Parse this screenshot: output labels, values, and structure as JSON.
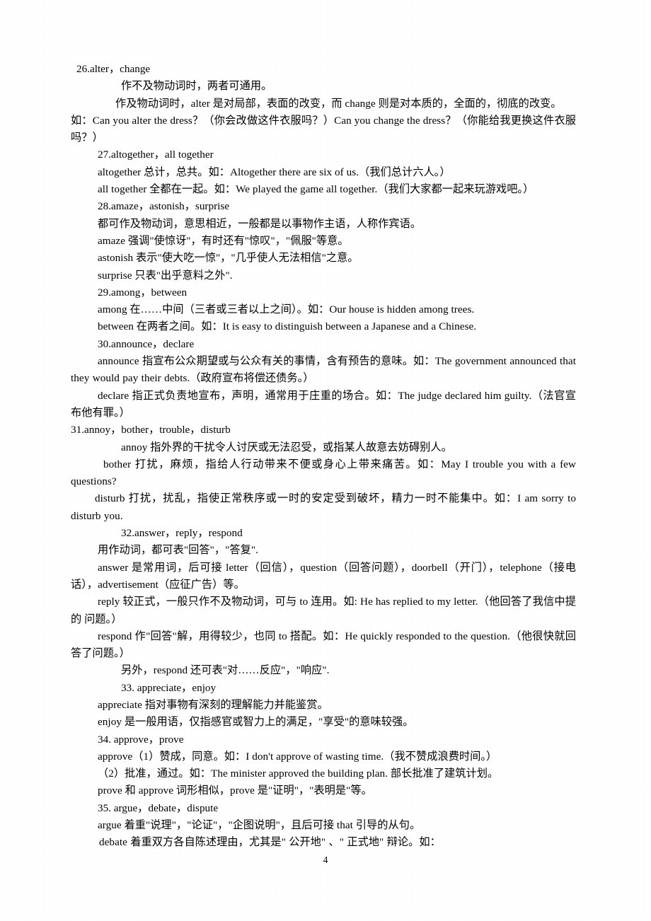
{
  "document": {
    "page_number": "4",
    "entries": [
      {
        "id": "26",
        "heading": "26.alter，change",
        "lines": [
          {
            "text": "作不及物动词时，两者可通用。",
            "indent": "ind2",
            "justify": false
          },
          {
            "text": "作及物动词时，alter 是对局部，表面的改变，而 change 则是对本质的，全面的，彻底的改变。",
            "indent": "ind2",
            "justify": true
          },
          {
            "text": "如：Can you alter the dress？（你会改做这件衣服吗？）Can you change the dress？（你能给我更换这件衣服吗？）",
            "indent": "hang",
            "justify": true
          }
        ]
      },
      {
        "id": "27",
        "heading": "27.altogether，all together",
        "lines": [
          {
            "text": "altogether 总计，总共。如：Altogether there are six of us.（我们总计六人。）",
            "indent": "ind1",
            "justify": false
          },
          {
            "text": "all together 全都在一起。如：We played the game all together.（我们大家都一起来玩游戏吧。）",
            "indent": "ind1",
            "justify": false
          }
        ]
      },
      {
        "id": "28",
        "heading": "28.amaze，astonish，surprise",
        "lines": [
          {
            "text": "都可作及物动词，意思相近，一般都是以事物作主语，人称作宾语。",
            "indent": "ind1",
            "justify": false
          },
          {
            "text": "amaze 强调\"使惊讶\"，有时还有\"惊叹\"，\"佩服\"等意。",
            "indent": "ind1",
            "justify": false
          },
          {
            "text": "astonish 表示\"使大吃一惊\"，\"几乎使人无法相信\"之意。",
            "indent": "ind1",
            "justify": false
          },
          {
            "text": "surprise 只表\"出乎意料之外\".",
            "indent": "ind1",
            "justify": false
          }
        ]
      },
      {
        "id": "29",
        "heading": "29.among，between",
        "lines": [
          {
            "text": "among 在……中间（三者或三者以上之间）。如：Our house is hidden among trees.",
            "indent": "ind1",
            "justify": false
          },
          {
            "text": "between 在两者之间。如：It is easy to distinguish between a Japanese and a Chinese.",
            "indent": "ind1",
            "justify": false
          }
        ]
      },
      {
        "id": "30",
        "heading": "30.announce，declare",
        "lines": [
          {
            "text": "announce 指宣布公众期望或与公众有关的事情，含有预告的意味。如：The government announced that they would pay their debts.（政府宣布将偿还债务。）",
            "indent": "hang",
            "justify": true
          },
          {
            "text": "declare 指正式负责地宣布，声明，通常用于庄重的场合。如：The judge declared him guilty.（法官宣布他有罪。）",
            "indent": "hang",
            "justify": true
          }
        ]
      },
      {
        "id": "31",
        "heading": "31.annoy，bother，trouble，disturb",
        "heading_indent": "ind0",
        "lines": [
          {
            "text": "annoy 指外界的干扰令人讨厌或无法忍受，或指某人故意去妨碍别人。",
            "indent": "ind1",
            "justify": false
          },
          {
            "text": "bother 打扰，麻烦，指给人行动带来不便或身心上带来痛苦。如：May I trouble you with a few questions?",
            "indent": "hang",
            "justify": true
          },
          {
            "text": "disturb 打扰，扰乱，指使正常秩序或一时的安定受到破坏，精力一时不能集中。如：I am sorry to disturb you.",
            "indent": "hang",
            "justify": true
          }
        ]
      },
      {
        "id": "32",
        "heading": "32.answer，reply，respond",
        "lines": [
          {
            "text": "用作动词，都可表\"回答\"，\"答复\".",
            "indent": "ind1",
            "justify": false
          },
          {
            "text": "answer 是常用词，后可接 letter（回信），question（回答问题），doorbell（开门），telephone（接电话），advertisement（应征广告）等。",
            "indent": "hang",
            "justify": true
          },
          {
            "text": "reply 较正式，一般只作不及物动词，可与 to 连用。如: He has replied to my letter.（他回答了我信中提的 问题。）",
            "indent": "hang",
            "justify": true
          },
          {
            "text": "respond 作\"回答\"解，用得较少，也同 to 搭配。如：He quickly responded to the question.（他很快就回答了问题。）",
            "indent": "hang",
            "justify": true
          },
          {
            "text": "另外，respond 还可表\"对……反应\"，\"响应\".",
            "indent": "ind1",
            "justify": false
          }
        ]
      },
      {
        "id": "33",
        "heading": "33. appreciate，enjoy",
        "lines": [
          {
            "text": "appreciate 指对事物有深刻的理解能力并能鉴赏。",
            "indent": "ind1",
            "justify": false
          },
          {
            "text": "enjoy 是一般用语，仅指感官或智力上的满足，\"享受\"的意味较强。",
            "indent": "ind1",
            "justify": false
          }
        ]
      },
      {
        "id": "34",
        "heading": "34. approve，prove",
        "lines": [
          {
            "text": "approve（1）赞成，同意。如：I don't approve of wasting time.（我不赞成浪费时间。）",
            "indent": "ind1",
            "justify": false
          },
          {
            "text": "（2）批准，通过。如：The minister approved the building plan. 部长批准了建筑计划。",
            "indent": "ind1",
            "justify": false
          },
          {
            "text": "prove 和 approve 词形相似，prove 是\"证明\"，\"表明是\"等。",
            "indent": "ind1",
            "justify": false
          }
        ]
      },
      {
        "id": "35",
        "heading": "35. argue，debate，dispute",
        "lines": [
          {
            "text": "argue 着重\"说理\"，\"论证\"，\"企图说明\"，且后可接 that 引导的从句。",
            "indent": "ind1",
            "justify": false
          },
          {
            "text": "debate 着重双方各自陈述理由，尤其是\" 公开地\" 、\" 正式地\" 辩论。如：",
            "indent": "ind1",
            "justify": true
          }
        ]
      }
    ]
  }
}
